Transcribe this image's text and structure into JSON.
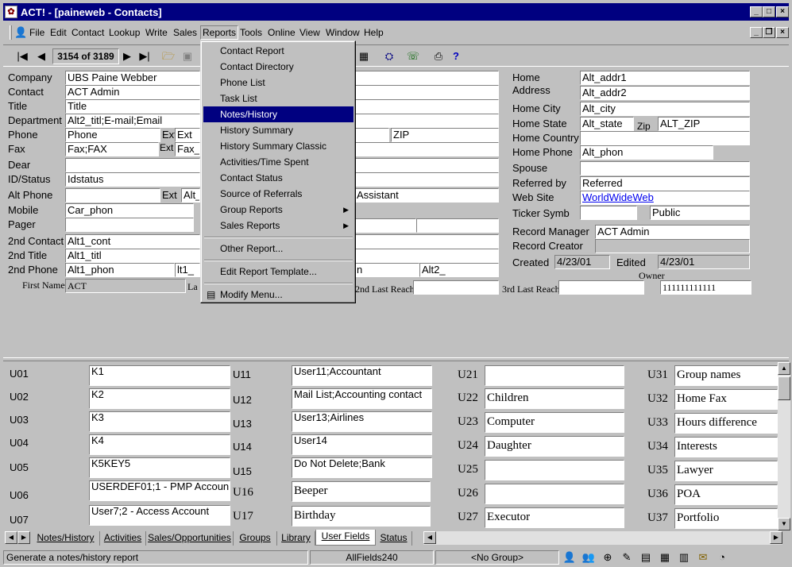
{
  "window": {
    "title": "ACT! - [paineweb - Contacts]",
    "app_icon": "act-app-icon",
    "controls": [
      "minimize",
      "maximize",
      "close"
    ]
  },
  "menubar": {
    "items": [
      "File",
      "Edit",
      "Contact",
      "Lookup",
      "Write",
      "Sales",
      "Reports",
      "Tools",
      "Online",
      "View",
      "Window",
      "Help"
    ],
    "active": "Reports"
  },
  "toolbar": {
    "record_counter": "3154 of 3189"
  },
  "reports_menu": {
    "items": [
      {
        "label": "Contact Report"
      },
      {
        "label": "Contact Directory"
      },
      {
        "label": "Phone List"
      },
      {
        "label": "Task List"
      },
      {
        "label": "Notes/History",
        "highlighted": true
      },
      {
        "label": "History Summary"
      },
      {
        "label": "History Summary Classic"
      },
      {
        "label": "Activities/Time Spent"
      },
      {
        "label": "Contact Status"
      },
      {
        "label": "Source of Referrals"
      },
      {
        "label": "Group Reports",
        "submenu": true
      },
      {
        "label": "Sales Reports",
        "submenu": true
      },
      {
        "label": "Other Report..."
      },
      {
        "label": "Edit Report Template..."
      },
      {
        "label": "Modify Menu..."
      }
    ]
  },
  "contact": {
    "labels": {
      "company": "Company",
      "contact": "Contact",
      "title": "Title",
      "department": "Department",
      "phone": "Phone",
      "ext": "Ext",
      "fax": "Fax",
      "dear": "Dear",
      "id_status": "ID/Status",
      "alt_phone": "Alt Phone",
      "mobile": "Mobile",
      "pager": "Pager",
      "second_contact": "2nd Contact",
      "second_title": "2nd Title",
      "second_phone": "2nd Phone",
      "first_name": "First Name",
      "last_name_partial": "La",
      "second_last_reach": "2nd Last Reach",
      "third_last_reach": "3rd Last Reach"
    },
    "values": {
      "company": "UBS Paine Webber",
      "contact": "ACT Admin",
      "title": "Title",
      "department": "Alt2_titl;E-mail;Email",
      "phone": "Phone",
      "phone_ext": "Ext",
      "fax": "Fax;FAX",
      "fax_ext_label": "Ext",
      "fax_ext": "Fax_e",
      "id_status": "Idstatus",
      "alt_phone_ext": "Alt_",
      "mobile": "Car_phon",
      "second_contact": "Alt1_cont",
      "second_title": "Alt1_titl",
      "second_phone": "Alt1_phon",
      "second_phone_ext": "lt1_",
      "first_name": "ACT",
      "zip": "ZIP",
      "assistant": "Assistant",
      "mid_alt2": "Alt2_",
      "mid_partial": "n"
    }
  },
  "home": {
    "labels": {
      "home": "Home",
      "address": "Address",
      "city": "Home City",
      "state": "Home State",
      "zip": "Zip",
      "country": "Home Country",
      "phone": "Home Phone",
      "spouse": "Spouse",
      "referred_by": "Referred by",
      "web_site": "Web Site",
      "ticker": "Ticker Symb",
      "record_manager": "Record Manager",
      "record_creator": "Record Creator",
      "created": "Created",
      "edited": "Edited",
      "owner": "Owner"
    },
    "values": {
      "addr1": "Alt_addr1",
      "addr2": "Alt_addr2",
      "city": "Alt_city",
      "state": "Alt_state",
      "zip": "ALT_ZIP",
      "phone": "Alt_phon",
      "referred_by": "Referred",
      "web_site": "WorldWideWeb",
      "public": "Public",
      "record_manager": "ACT Admin",
      "created": "4/23/01",
      "edited": "4/23/01",
      "owner_value": "111111111111"
    }
  },
  "user_fields": {
    "col1": [
      {
        "label": "U01",
        "value": "K1"
      },
      {
        "label": "U02",
        "value": "K2"
      },
      {
        "label": "U03",
        "value": "K3"
      },
      {
        "label": "U04",
        "value": "K4"
      },
      {
        "label": "U05",
        "value": "K5KEY5"
      },
      {
        "label": "U06",
        "value": "USERDEF01;1 - PMP Accoun"
      },
      {
        "label": "U07",
        "value": "User7;2 - Access Account"
      }
    ],
    "col2": [
      {
        "label": "U11",
        "value": "User11;Accountant"
      },
      {
        "label": "U12",
        "value": "Mail List;Accounting contact"
      },
      {
        "label": "U13",
        "value": "User13;Airlines"
      },
      {
        "label": "U14",
        "value": "User14"
      },
      {
        "label": "U15",
        "value": "Do Not Delete;Bank"
      },
      {
        "label": "U16",
        "value": "Beeper"
      },
      {
        "label": "U17",
        "value": "Birthday"
      }
    ],
    "col3": [
      {
        "label": "U21",
        "value": ""
      },
      {
        "label": "U22",
        "value": "Children"
      },
      {
        "label": "U23",
        "value": "Computer"
      },
      {
        "label": "U24",
        "value": "Daughter"
      },
      {
        "label": "U25",
        "value": ""
      },
      {
        "label": "U26",
        "value": ""
      },
      {
        "label": "U27",
        "value": "Executor"
      }
    ],
    "col4": [
      {
        "label": "U31",
        "value": "Group names"
      },
      {
        "label": "U32",
        "value": "Home Fax"
      },
      {
        "label": "U33",
        "value": "Hours difference"
      },
      {
        "label": "U34",
        "value": "Interests"
      },
      {
        "label": "U35",
        "value": "Lawyer"
      },
      {
        "label": "U36",
        "value": "POA"
      },
      {
        "label": "U37",
        "value": "Portfolio"
      }
    ]
  },
  "tabs": {
    "items": [
      "Notes/History",
      "Activities",
      "Sales/Opportunities",
      "Groups",
      "Library",
      "User Fields",
      "Status"
    ],
    "active": "User Fields"
  },
  "statusbar": {
    "message": "Generate a notes/history report",
    "layout": "AllFields240",
    "group": "<No Group>"
  }
}
